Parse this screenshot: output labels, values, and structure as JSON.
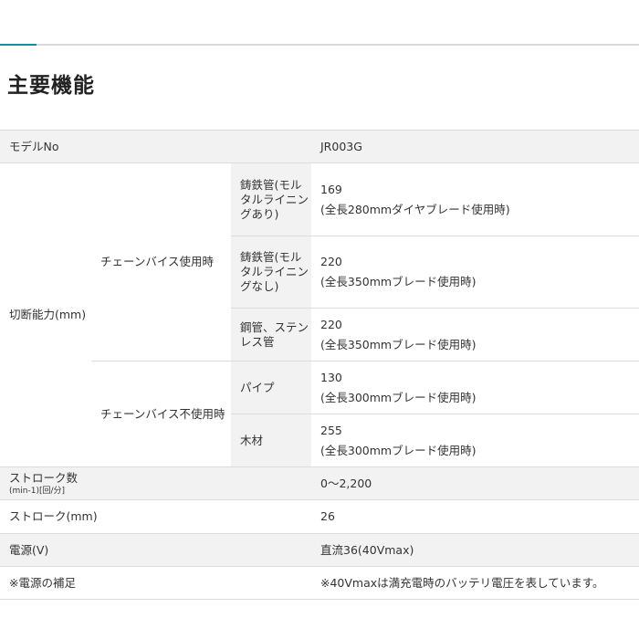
{
  "section_title": "主要機能",
  "model": {
    "label": "モデルNo",
    "value": "JR003G"
  },
  "cutting": {
    "label": "切断能力(mm)",
    "with_vise": {
      "label": "チェーンバイス使用時",
      "rows": [
        {
          "item": [
            "鋳鉄管(モル",
            "タルライニン",
            "グあり)"
          ],
          "value": "169",
          "note": "(全長280mmダイヤブレード使用時)"
        },
        {
          "item": [
            "鋳鉄管(モル",
            "タルライニン",
            "グなし)"
          ],
          "value": "220",
          "note": "(全長350mmブレード使用時)"
        },
        {
          "item": [
            "鋼管、ステン",
            "レス管"
          ],
          "value": "220",
          "note": "(全長350mmブレード使用時)"
        }
      ]
    },
    "without_vise": {
      "label": "チェーンバイス不使用時",
      "rows": [
        {
          "item": [
            "パイプ"
          ],
          "value": "130",
          "note": "(全長300mmブレード使用時)"
        },
        {
          "item": [
            "木材"
          ],
          "value": "255",
          "note": "(全長300mmブレード使用時)"
        }
      ]
    }
  },
  "stroke_rate": {
    "label": "ストローク数",
    "sublabel": "(min-1)[回/分]",
    "value": "0〜2,200"
  },
  "stroke": {
    "label": "ストローク(mm)",
    "value": "26"
  },
  "power": {
    "label": "電源(V)",
    "value": "直流36(40Vmax)"
  },
  "power_note": {
    "label": "※電源の補足",
    "value": "※40Vmaxは満充電時のバッテリ電圧を表しています。"
  },
  "colors": {
    "accent": "#0d8fa0",
    "shade": "#f2f2f2",
    "border": "#dcdcdc",
    "text": "#333333"
  }
}
